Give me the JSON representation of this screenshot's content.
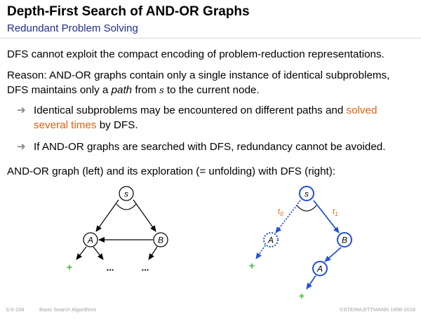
{
  "header": {
    "title": "Depth-First Search of AND-OR Graphs",
    "subtitle": "Redundant Problem Solving"
  },
  "body": {
    "intro": "DFS cannot exploit the compact encoding of problem-reduction representations.",
    "reason_line1": "Reason: AND-OR graphs contain only a single instance of identical subproblems,",
    "reason_line2_pre": "DFS maintains only a ",
    "reason_line2_em": "path",
    "reason_line2_mid": " from ",
    "reason_line2_var": "s",
    "reason_line2_post": " to the current node.",
    "bullet1_line1_pre": "Identical subproblems may be encountered on different paths and ",
    "bullet1_line1_hl": "solved",
    "bullet1_line2_hl": "several times",
    "bullet1_line2_post": " by DFS.",
    "bullet2": "If AND-OR graphs are searched with DFS, redundancy cannot be avoided.",
    "caption": "AND-OR graph (left) and its exploration (= unfolding) with DFS (right):"
  },
  "bullet_glyph": "➜",
  "left_graph": {
    "node_s": "s",
    "node_a": "A",
    "node_b": "B",
    "solved_mark": "+",
    "ellipsis_1": "...",
    "ellipsis_2": "..."
  },
  "right_graph": {
    "node_s": "s",
    "node_a_dotted": "A",
    "node_b": "B",
    "node_a": "A",
    "label_t0": "t",
    "label_t0_sub": "0",
    "label_t1": "t",
    "label_t1_sub": "1",
    "solved_mark_1": "+",
    "solved_mark_2": "+"
  },
  "colors": {
    "subtitle": "#1e2f8c",
    "highlight": "#e06010",
    "graph_blue": "#1f4fe0",
    "plus_green": "#3cbf3c",
    "footer_gray": "#a0a0a0"
  },
  "footer": {
    "slide_id": "S:II-158",
    "section": "Basic Search Algorithms",
    "copyright": "©STEIN/LETTMANN 1998-2018"
  }
}
